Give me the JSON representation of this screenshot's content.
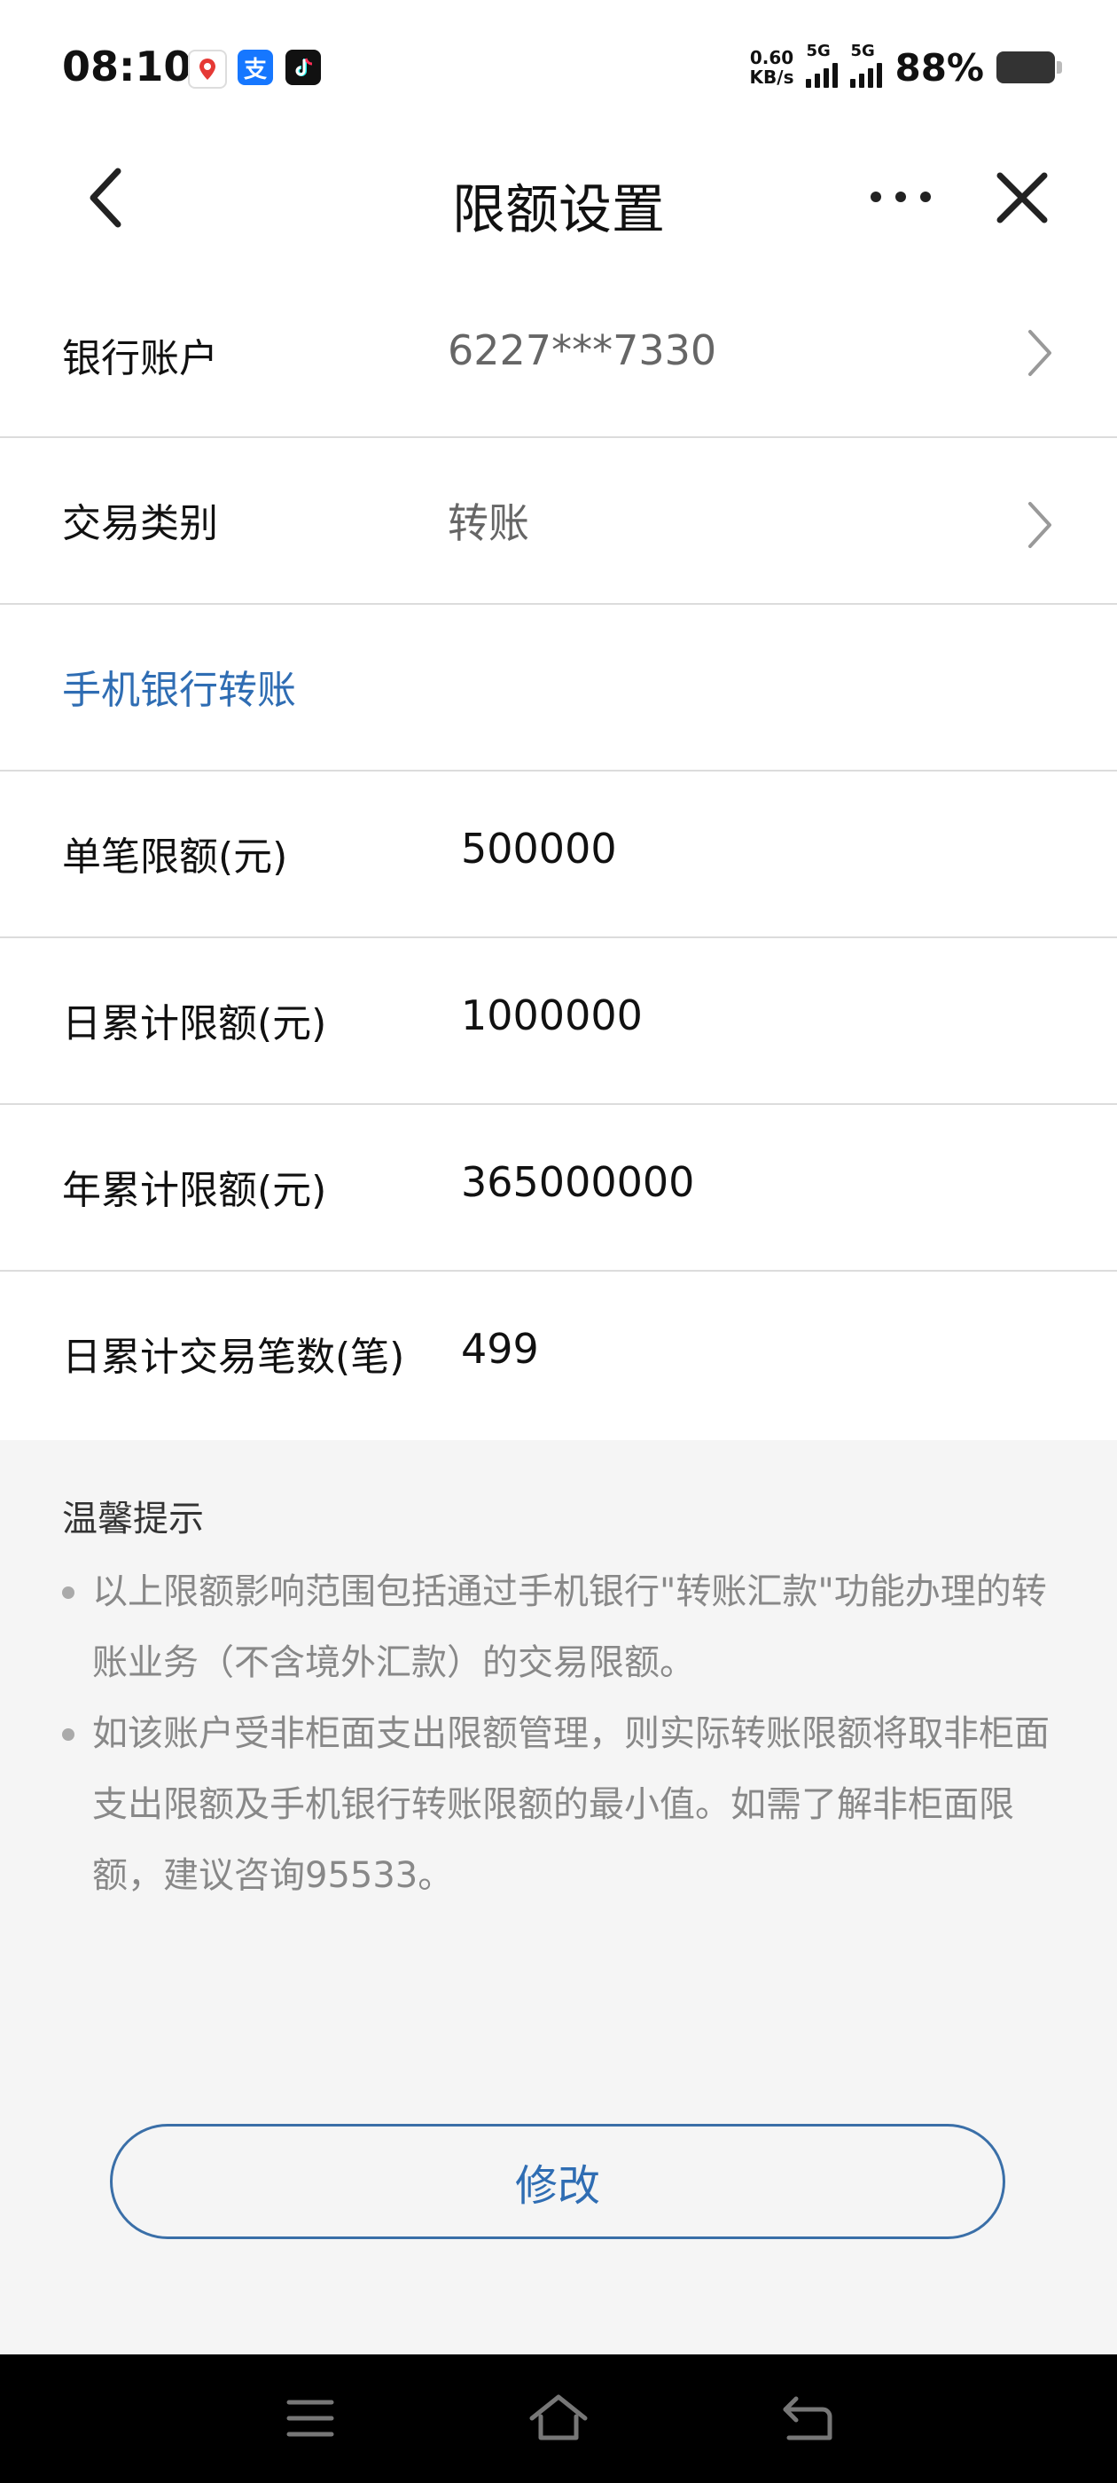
{
  "status_bar": {
    "time": "08:10",
    "net_speed_value": "0.60",
    "net_speed_unit": "KB/s",
    "signal_1_label": "5G",
    "signal_2_label": "5G",
    "battery_percent": "88%",
    "app_icons": [
      "maps-icon",
      "alipay-icon",
      "tiktok-icon"
    ],
    "alipay_glyph": "支"
  },
  "nav": {
    "title": "限额设置"
  },
  "rows": {
    "account": {
      "label": "银行账户",
      "value": "6227***7330"
    },
    "category": {
      "label": "交易类别",
      "value": "转账"
    },
    "section": {
      "title": "手机银行转账"
    },
    "single_limit": {
      "label": "单笔限额(元)",
      "value": "500000"
    },
    "daily_limit": {
      "label": "日累计限额(元)",
      "value": "1000000"
    },
    "yearly_limit": {
      "label": "年累计限额(元)",
      "value": "365000000"
    },
    "daily_count": {
      "label": "日累计交易笔数(笔)",
      "value": "499"
    }
  },
  "tips": {
    "title": "温馨提示",
    "items": [
      "以上限额影响范围包括通过手机银行\"转账汇款\"功能办理的转账业务（不含境外汇款）的交易限额。",
      "如该账户受非柜面支出限额管理，则实际转账限额将取非柜面支出限额及手机银行转账限额的最小值。如需了解非柜面限额，建议咨询95533。"
    ]
  },
  "actions": {
    "modify_label": "修改"
  },
  "colors": {
    "accent": "#2f6db3",
    "background": "#f5f5f5"
  }
}
